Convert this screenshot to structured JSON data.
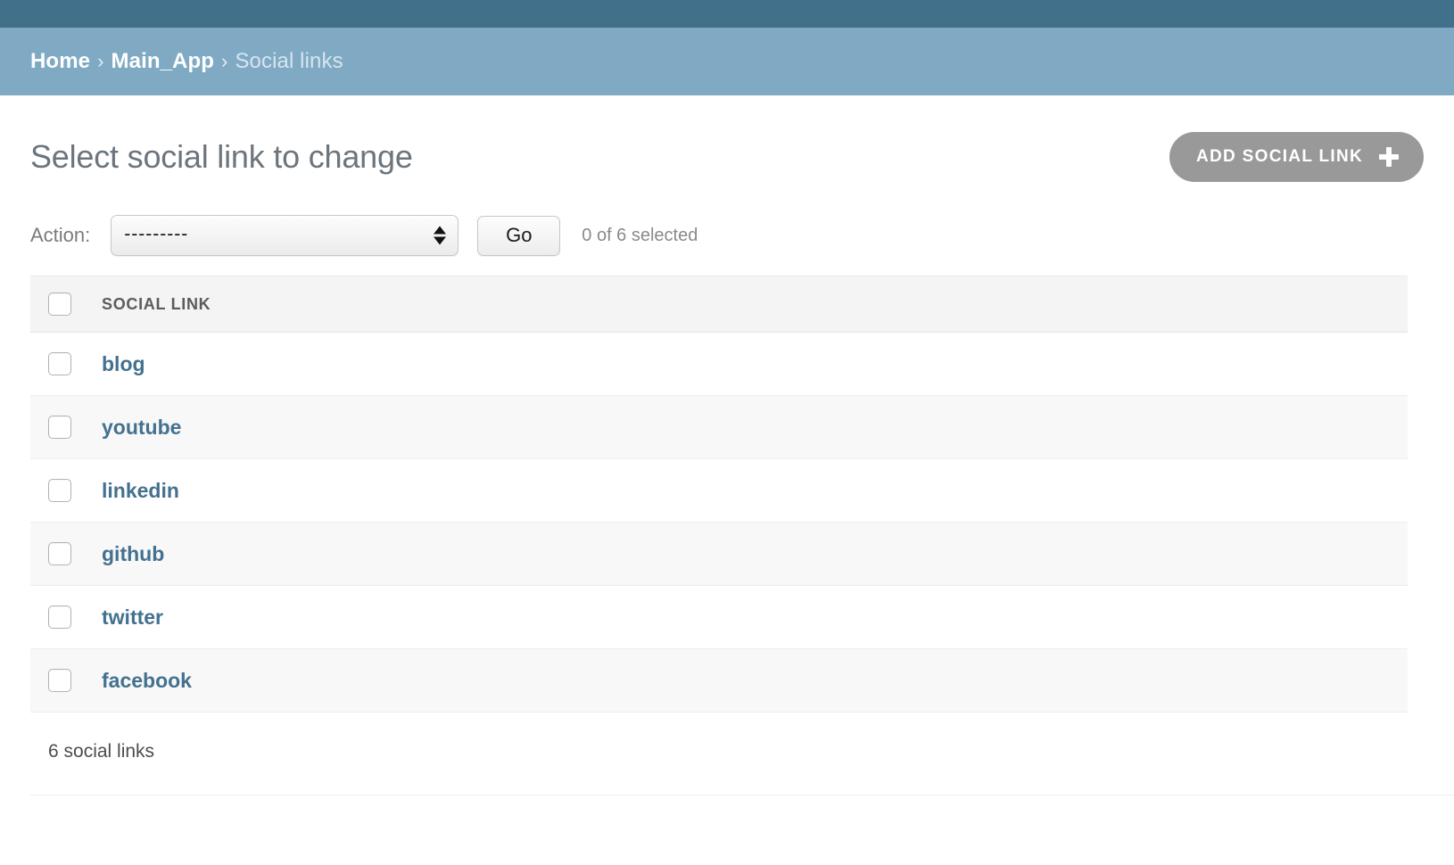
{
  "theme": {
    "topbar_color": "#41708a",
    "breadcrumb_bg": "#80aac4",
    "link_color": "#43718f",
    "button_color": "#999999",
    "title_color": "#6c757d"
  },
  "breadcrumbs": {
    "home_label": "Home",
    "app_label": "Main_App",
    "current_label": "Social links",
    "separator": "›"
  },
  "header": {
    "page_title": "Select social link to change",
    "add_button_label": "ADD SOCIAL LINK",
    "add_button_icon": "plus-icon"
  },
  "actions": {
    "label": "Action:",
    "selected_option": "---------",
    "options": [
      "---------"
    ],
    "go_label": "Go",
    "selection_counter": "0 of 6 selected"
  },
  "table": {
    "columns": [
      "SOCIAL LINK"
    ],
    "select_all_checkbox": "select-all",
    "rows": [
      {
        "name": "blog"
      },
      {
        "name": "youtube"
      },
      {
        "name": "linkedin"
      },
      {
        "name": "github"
      },
      {
        "name": "twitter"
      },
      {
        "name": "facebook"
      }
    ]
  },
  "footer": {
    "count_text": "6 social links"
  }
}
